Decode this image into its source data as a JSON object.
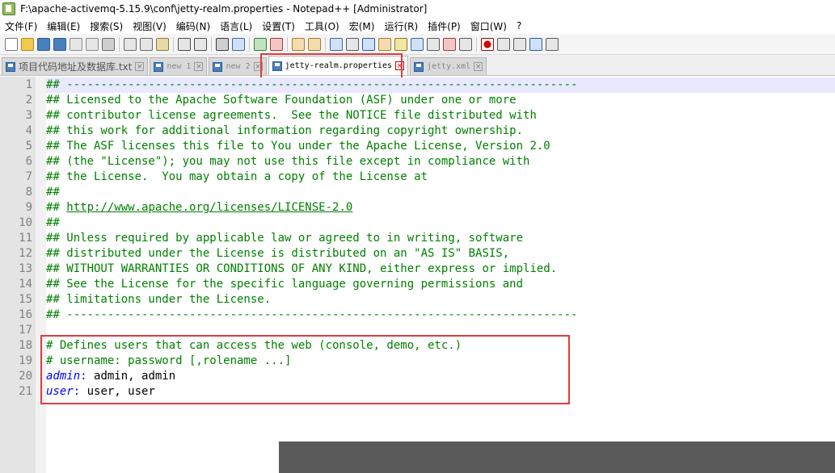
{
  "window": {
    "title": "F:\\apache-activemq-5.15.9\\conf\\jetty-realm.properties - Notepad++ [Administrator]"
  },
  "menu": [
    "文件(F)",
    "编辑(E)",
    "搜索(S)",
    "视图(V)",
    "编码(N)",
    "语言(L)",
    "设置(T)",
    "工具(O)",
    "宏(M)",
    "运行(R)",
    "插件(P)",
    "窗口(W)",
    "?"
  ],
  "tabs": [
    {
      "label": "项目代码地址及数据库.txt",
      "active": false
    },
    {
      "label": "new 1",
      "active": false
    },
    {
      "label": "new 2",
      "active": false
    },
    {
      "label": "jetty-realm.properties",
      "active": true
    },
    {
      "label": "jetty.xml",
      "active": false
    }
  ],
  "editor": {
    "lines": [
      "## ---------------------------------------------------------------------------",
      "## Licensed to the Apache Software Foundation (ASF) under one or more",
      "## contributor license agreements.  See the NOTICE file distributed with",
      "## this work for additional information regarding copyright ownership.",
      "## The ASF licenses this file to You under the Apache License, Version 2.0",
      "## (the \"License\"); you may not use this file except in compliance with",
      "## the License.  You may obtain a copy of the License at",
      "##",
      "## http://www.apache.org/licenses/LICENSE-2.0",
      "##",
      "## Unless required by applicable law or agreed to in writing, software",
      "## distributed under the License is distributed on an \"AS IS\" BASIS,",
      "## WITHOUT WARRANTIES OR CONDITIONS OF ANY KIND, either express or implied.",
      "## See the License for the specific language governing permissions and",
      "## limitations under the License.",
      "## ---------------------------------------------------------------------------",
      "",
      "# Defines users that can access the web (console, demo, etc.)",
      "# username: password [,rolename ...]",
      "admin: admin, admin",
      "user: user, user"
    ],
    "link_prefix": "## ",
    "link_text": "http://www.apache.org/licenses/LICENSE-2.0",
    "current_line": 1
  },
  "colors": {
    "comment": "#008000",
    "key": "#0000ff",
    "highlight_box": "#e03c3c"
  }
}
